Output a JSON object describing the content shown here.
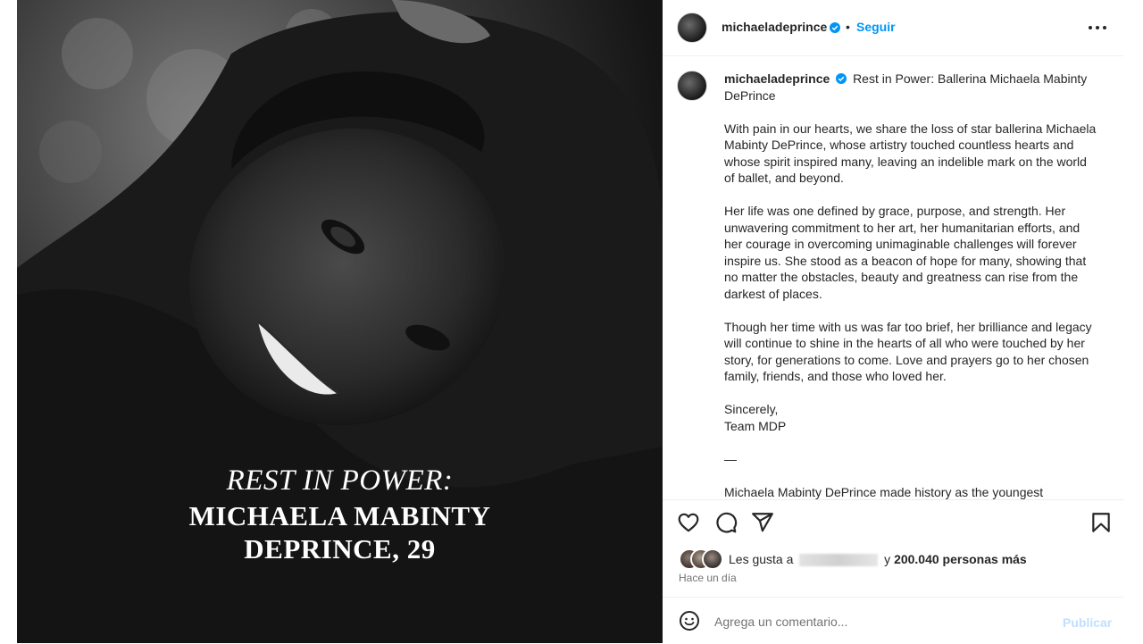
{
  "post": {
    "overlay_line1": "REST IN POWER:",
    "overlay_line2": "MICHAELA MABINTY",
    "overlay_line3": "DEPRINCE, 29"
  },
  "header": {
    "username": "michaeladeprince",
    "separator": "•",
    "follow_label": "Seguir"
  },
  "caption": {
    "username": "michaeladeprince",
    "title": "Rest in Power: Ballerina Michaela Mabinty DePrince",
    "paragraphs": [
      "With pain in our hearts, we share the loss of star ballerina Michaela Mabinty DePrince, whose artistry touched countless hearts and whose spirit inspired many, leaving an indelible mark on the world of ballet, and beyond.",
      "Her life was one defined by grace, purpose, and strength. Her unwavering commitment to her art, her humanitarian efforts, and her courage in overcoming unimaginable challenges will forever inspire us. She stood as a beacon of hope for many, showing that no matter the obstacles, beauty and greatness can rise from the darkest of places.",
      "Though her time with us was far too brief, her brilliance and legacy will continue to shine in the hearts of all who were touched by her story, for generations to come. Love and prayers go to her chosen family, friends, and those who loved her.",
      "Sincerely,",
      "Team MDP",
      "—",
      "Michaela Mabinty DePrince made history as the youngest"
    ]
  },
  "likes": {
    "prefix": "Les gusta a",
    "suffix": "y",
    "count": "200.040 personas más"
  },
  "timestamp": "Hace un día",
  "comment": {
    "placeholder": "Agrega un comentario...",
    "publish_label": "Publicar"
  },
  "colors": {
    "accent": "#0095f6",
    "publish_disabled": "#c0dffd",
    "text": "#262626",
    "secondary": "#737373",
    "border": "#efefef"
  },
  "icons": [
    "verified-badge-icon",
    "more-options-icon",
    "heart-icon",
    "comment-icon",
    "share-icon",
    "save-icon",
    "emoji-icon"
  ]
}
